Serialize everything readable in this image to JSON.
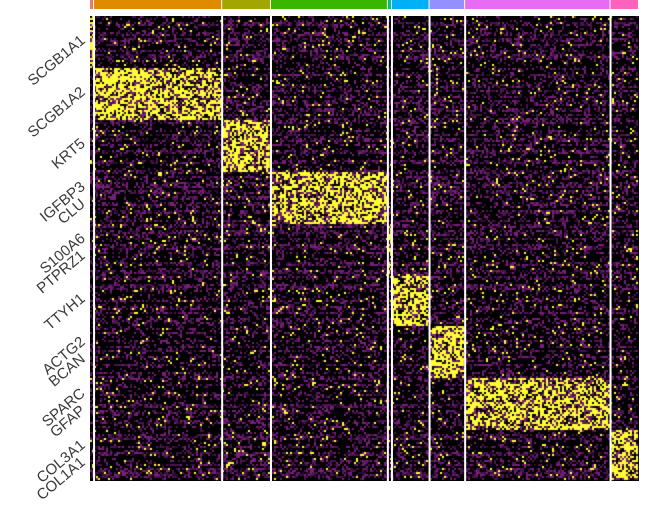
{
  "chart_data": {
    "type": "heatmap",
    "title": "",
    "xlabel": "",
    "ylabel": "",
    "colors": {
      "low": "#000000",
      "mid": "#7a1e7a",
      "high": "#ffff33",
      "separator": "#ffffff"
    },
    "cluster_groups": [
      {
        "color": "#f0766d",
        "cells": 4
      },
      {
        "color": "#e08a00",
        "cells": 126
      },
      {
        "color": "#a3a500",
        "cells": 48
      },
      {
        "color": "#39b600",
        "cells": 115
      },
      {
        "color": "#00bf7d",
        "cells": 4
      },
      {
        "color": "#00b0f6",
        "cells": 37
      },
      {
        "color": "#9590ff",
        "cells": 35
      },
      {
        "color": "#e76bf3",
        "cells": 143
      },
      {
        "color": "#ff62bc",
        "cells": 28
      }
    ],
    "gene_blocks": [
      {
        "high_group": 0,
        "labels": [
          "SCGB1A1"
        ]
      },
      {
        "high_group": 1,
        "labels": [
          "SCGB1A2"
        ]
      },
      {
        "high_group": 2,
        "labels": [
          "KRT5"
        ]
      },
      {
        "high_group": 3,
        "labels": [
          "IGFBP3",
          "CLU"
        ]
      },
      {
        "high_group": 4,
        "labels": [
          "S100A6",
          "PTPRZ1"
        ]
      },
      {
        "high_group": 5,
        "labels": [
          "TTYH1"
        ]
      },
      {
        "high_group": 6,
        "labels": [
          "ACTG2",
          "BCAN"
        ]
      },
      {
        "high_group": 7,
        "labels": [
          "SPARC",
          "GFAP"
        ]
      },
      {
        "high_group": 8,
        "labels": [
          "COL3A1",
          "COL1A1"
        ]
      }
    ]
  }
}
